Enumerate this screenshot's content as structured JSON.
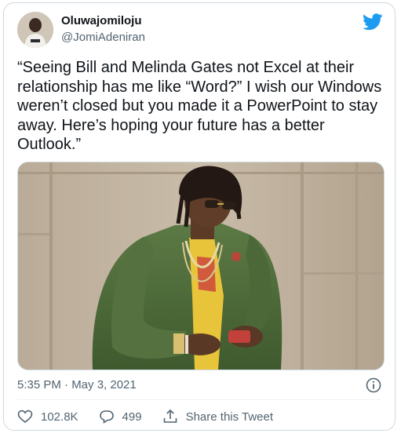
{
  "user": {
    "display_name": "Oluwajomiloju",
    "handle": "@JomiAdeniran"
  },
  "tweet": {
    "text": "“Seeing Bill and Melinda Gates not Excel at their relationship has me like “Word?” I wish our Windows weren’t closed but you made it a PowerPoint to stay away. Here’s hoping your future has a better Outlook.”",
    "timestamp": "5:35 PM · May 3, 2021"
  },
  "actions": {
    "like_count": "102.8K",
    "reply_count": "499",
    "share_label": "Share this Tweet"
  },
  "icons": {
    "brand": "twitter-bird-icon",
    "info": "info-icon",
    "like": "heart-icon",
    "reply": "reply-icon",
    "share": "share-icon"
  },
  "colors": {
    "brand_blue": "#1d9bf0",
    "text_primary": "#0f1419",
    "text_secondary": "#536471",
    "border": "#cfd9de",
    "jacket_green": "#4f6a3a"
  }
}
